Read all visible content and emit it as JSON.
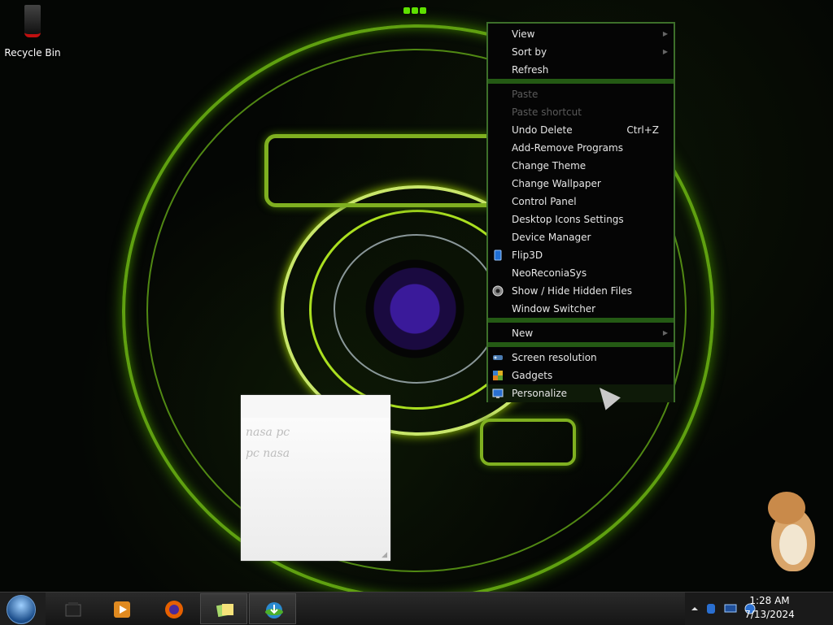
{
  "desktop": {
    "icons": [
      {
        "label": "Recycle Bin",
        "icon": "recycle-bin-icon"
      }
    ]
  },
  "sticky_note": {
    "lines": [
      "nasa pc",
      "pc nasa"
    ]
  },
  "context_menu": {
    "group1": [
      {
        "label": "View",
        "submenu": true
      },
      {
        "label": "Sort by",
        "submenu": true
      },
      {
        "label": "Refresh"
      }
    ],
    "group2": [
      {
        "label": "Paste",
        "disabled": true
      },
      {
        "label": "Paste shortcut",
        "disabled": true
      },
      {
        "label": "Undo Delete",
        "shortcut": "Ctrl+Z"
      },
      {
        "label": "Add-Remove Programs"
      },
      {
        "label": "Change Theme"
      },
      {
        "label": "Change Wallpaper"
      },
      {
        "label": "Control Panel"
      },
      {
        "label": "Desktop Icons Settings"
      },
      {
        "label": "Device Manager"
      },
      {
        "label": "Flip3D",
        "icon": "flip3d-icon"
      },
      {
        "label": "NeoReconiaSys"
      },
      {
        "label": "Show / Hide Hidden Files",
        "icon": "eye-icon"
      },
      {
        "label": "Window Switcher"
      }
    ],
    "group3": [
      {
        "label": "New",
        "submenu": true
      }
    ],
    "group4": [
      {
        "label": "Screen resolution",
        "icon": "display-resolution-icon"
      },
      {
        "label": "Gadgets",
        "icon": "gadgets-icon"
      },
      {
        "label": "Personalize",
        "icon": "personalize-icon"
      }
    ]
  },
  "taskbar": {
    "start_icon": "windows-logo-icon",
    "pinned": [
      {
        "name": "file-explorer-icon"
      },
      {
        "name": "media-player-icon"
      },
      {
        "name": "firefox-icon"
      },
      {
        "name": "sticky-notes-icon"
      },
      {
        "name": "internet-download-manager-icon"
      }
    ],
    "tray": {
      "show_hidden_icon": "chevron-up-icon",
      "clock_time": "1:28 AM",
      "clock_date": "7/13/2024"
    }
  },
  "colors": {
    "menu_border": "#3d6f2a",
    "menu_separator": "#245a14",
    "wallpaper_glow": "#7fb020"
  }
}
